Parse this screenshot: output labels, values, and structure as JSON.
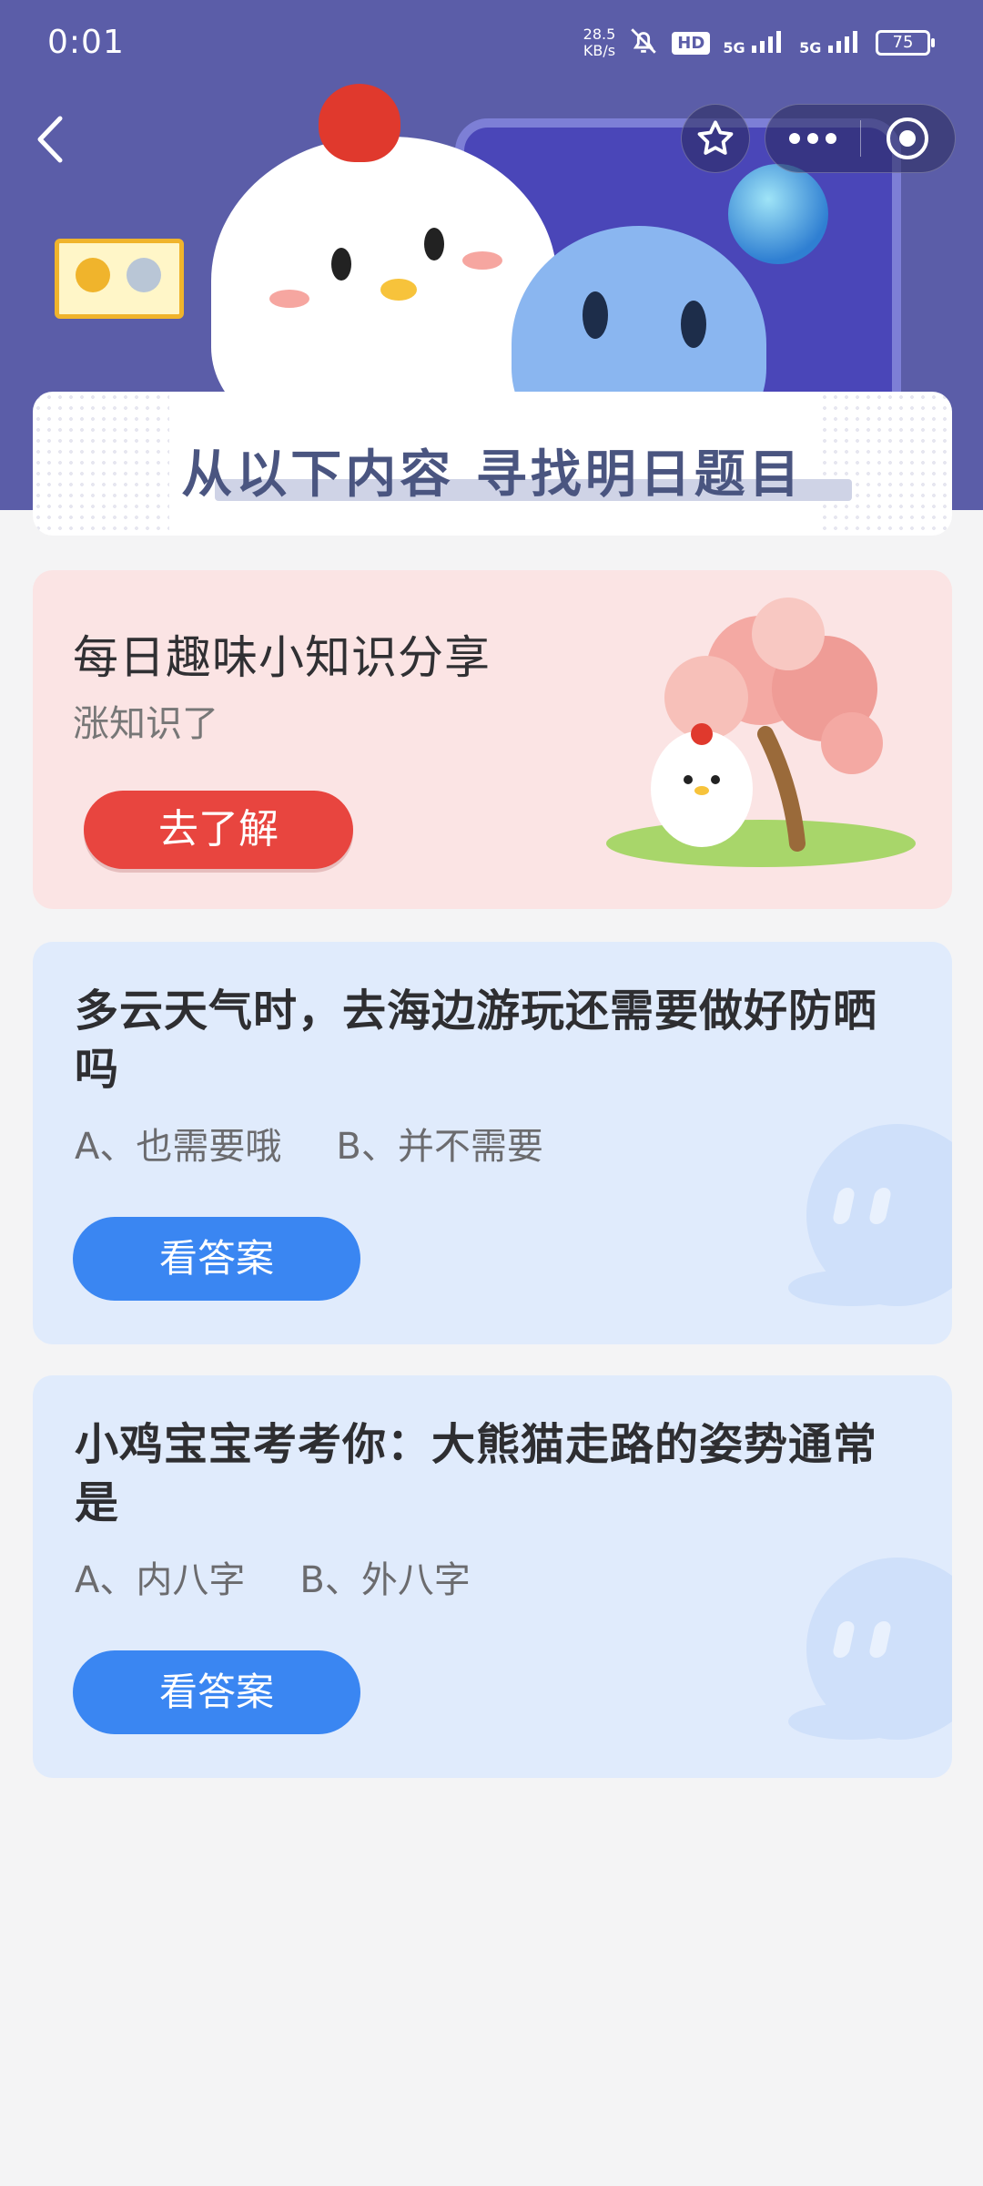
{
  "status_bar": {
    "time": "0:01",
    "net_speed_value": "28.5",
    "net_speed_unit": "KB/s",
    "hd": "HD",
    "sim1": "5G",
    "sim2": "5G",
    "battery": "75"
  },
  "banner": {
    "title": "从以下内容 寻找明日题目"
  },
  "knowledge_card": {
    "title": "每日趣味小知识分享",
    "subtitle": "涨知识了",
    "button": "去了解"
  },
  "questions": [
    {
      "title": "多云天气时，去海边游玩还需要做好防晒吗",
      "option_a": "A、也需要哦",
      "option_b": "B、并不需要",
      "button": "看答案"
    },
    {
      "title": "小鸡宝宝考考你：大熊猫走路的姿势通常是",
      "option_a": "A、内八字",
      "option_b": "B、外八字",
      "button": "看答案"
    }
  ],
  "colors": {
    "header_bg": "#5b5da8",
    "pink_card": "#fbe4e4",
    "pink_button": "#e8453f",
    "blue_card": "#e0ebfc",
    "blue_button": "#3a86f2"
  }
}
